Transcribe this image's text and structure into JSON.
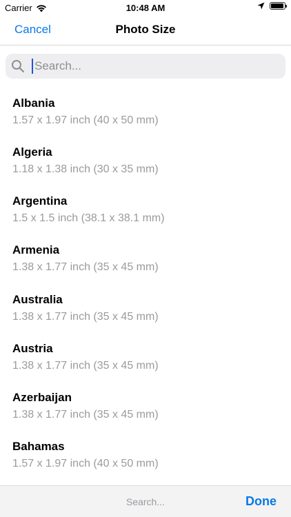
{
  "status_bar": {
    "carrier": "Carrier",
    "time": "10:48 AM"
  },
  "nav": {
    "cancel_label": "Cancel",
    "title": "Photo Size"
  },
  "search": {
    "placeholder": "Search..."
  },
  "countries": [
    {
      "name": "Albania",
      "size": "1.57 x 1.97 inch (40 x 50 mm)"
    },
    {
      "name": "Algeria",
      "size": "1.18 x 1.38 inch (30 x 35 mm)"
    },
    {
      "name": "Argentina",
      "size": "1.5 x 1.5 inch (38.1 x 38.1 mm)"
    },
    {
      "name": "Armenia",
      "size": "1.38 x 1.77 inch (35 x 45 mm)"
    },
    {
      "name": "Australia",
      "size": "1.38 x 1.77 inch (35 x 45 mm)"
    },
    {
      "name": "Austria",
      "size": "1.38 x 1.77 inch (35 x 45 mm)"
    },
    {
      "name": "Azerbaijan",
      "size": "1.38 x 1.77 inch (35 x 45 mm)"
    },
    {
      "name": "Bahamas",
      "size": "1.57 x 1.97 inch (40 x 50 mm)"
    }
  ],
  "keyboard_toolbar": {
    "search_label": "Search...",
    "done_label": "Done"
  },
  "colors": {
    "accent": "#0a78e6",
    "secondary_text": "#9a9aa0",
    "search_bg": "#eeeef0",
    "caret": "#1d54d8"
  }
}
